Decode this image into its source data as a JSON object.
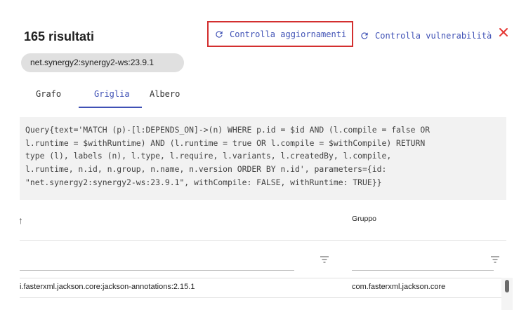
{
  "header": {
    "results_title": "165 risultati",
    "artifact_chip": "net.synergy2:synergy2-ws:23.9.1",
    "check_updates_label": "Controlla aggiornamenti",
    "check_vulnerabilities_label": "Controlla vulnerabilità",
    "close_icon": "close-icon"
  },
  "tabs": [
    {
      "label": "Grafo",
      "active": false
    },
    {
      "label": "Griglia",
      "active": true
    },
    {
      "label": "Albero",
      "active": false
    }
  ],
  "query_text": "Query{text='MATCH (p)-[l:DEPENDS_ON]->(n) WHERE p.id = $id AND (l.compile = false OR\nl.runtime = $withRuntime) AND (l.runtime = true OR l.compile = $withCompile) RETURN\ntype (l), labels (n), l.type, l.require, l.variants, l.createdBy, l.compile,\nl.runtime, n.id, n.group, n.name, n.version ORDER BY n.id', parameters={id:\n\"net.synergy2:synergy2-ws:23.9.1\", withCompile: FALSE, withRuntime: TRUE}}",
  "grid": {
    "columns": [
      {
        "label": "↑",
        "sort": "ascending"
      },
      {
        "label": "Gruppo"
      }
    ],
    "rows": [
      [
        "i.fasterxml.jackson.core:jackson-annotations:2.15.1",
        "com.fasterxml.jackson.core"
      ]
    ]
  },
  "colors": {
    "accent": "#3f51b5",
    "close": "#e53935",
    "highlight_border": "#d32f2f"
  }
}
